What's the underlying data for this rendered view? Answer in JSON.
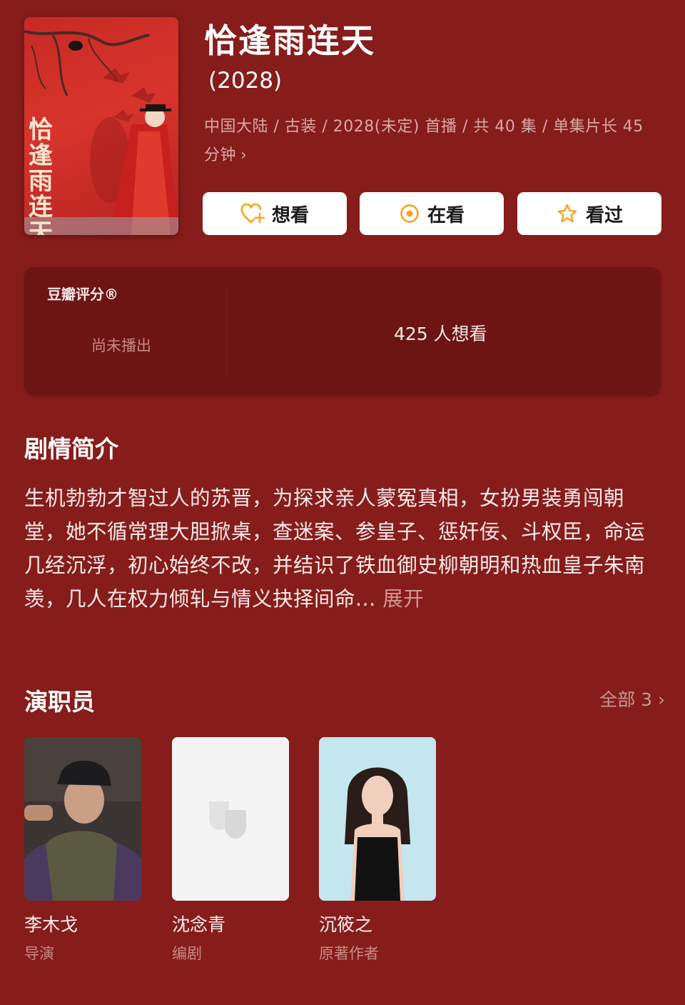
{
  "title": "恰逢雨连天",
  "year": "(2028)",
  "meta_text": "中国大陆 / 古装 / 2028(未定) 首播 / 共 40 集 / 单集片长 45 分钟",
  "poster": {
    "title_art": "恰逢雨连天"
  },
  "actions": [
    {
      "label": "想看",
      "icon": "heart-plus-icon"
    },
    {
      "label": "在看",
      "icon": "target-icon"
    },
    {
      "label": "看过",
      "icon": "star-icon"
    }
  ],
  "rating": {
    "label": "豆瓣评分®",
    "status": "尚未播出",
    "want_count": "425 人想看"
  },
  "synopsis": {
    "heading": "剧情简介",
    "text": "生机勃勃才智过人的苏晋，为探求亲人蒙冤真相，女扮男装勇闯朝堂，她不循常理大胆掀桌，查迷案、参皇子、惩奸佞、斗权臣，命运几经沉浮，初心始终不改，并结识了铁血御史柳朝明和热血皇子朱南羡，几人在权力倾轧与情义抉择间命...",
    "expand_label": "展开"
  },
  "cast": {
    "heading": "演职员",
    "all_label": "全部 3",
    "members": [
      {
        "name": "李木戈",
        "role": "导演"
      },
      {
        "name": "沈念青",
        "role": "编剧"
      },
      {
        "name": "沉筱之",
        "role": "原著作者"
      }
    ]
  },
  "colors": {
    "background": "#861d1b",
    "card": "#6c1514",
    "accent_orange": "#f5a41d",
    "muted_text": "#d8a9a5"
  }
}
